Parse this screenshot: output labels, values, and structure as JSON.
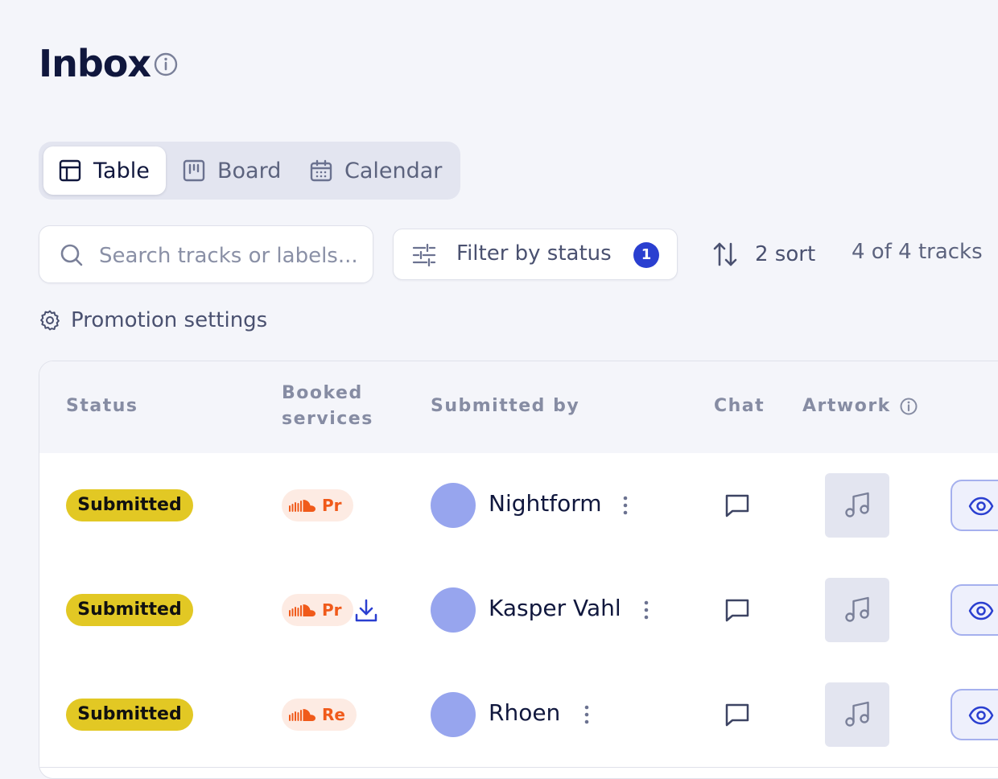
{
  "page": {
    "title": "Inbox"
  },
  "views": {
    "tabs": [
      {
        "label": "Table",
        "icon": "table-icon",
        "active": true
      },
      {
        "label": "Board",
        "icon": "board-icon",
        "active": false
      },
      {
        "label": "Calendar",
        "icon": "calendar-icon",
        "active": false
      }
    ]
  },
  "toolbar": {
    "search_placeholder": "Search tracks or labels...",
    "search_value": "",
    "filter_label": "Filter by status",
    "filter_count": "1",
    "sort_label": "2 sort",
    "track_count": "4 of 4 tracks"
  },
  "settings": {
    "promotion_label": "Promotion settings"
  },
  "table": {
    "columns": {
      "status": "Status",
      "booked_services": "Booked services",
      "submitted_by": "Submitted by",
      "chat": "Chat",
      "artwork": "Artwork"
    },
    "rows": [
      {
        "status": "Submitted",
        "service": "Pr",
        "has_download": false,
        "submitter": "Nightform"
      },
      {
        "status": "Submitted",
        "service": "Pr",
        "has_download": true,
        "submitter": "Kasper Vahl"
      },
      {
        "status": "Submitted",
        "service": "Re",
        "has_download": false,
        "submitter": "Rhoen"
      }
    ]
  },
  "colors": {
    "background": "#f4f5fa",
    "status_submitted": "#e2c824",
    "soundcloud_orange": "#f05a1a",
    "accent_blue": "#2a3fd0",
    "avatar": "#97a5ee"
  }
}
